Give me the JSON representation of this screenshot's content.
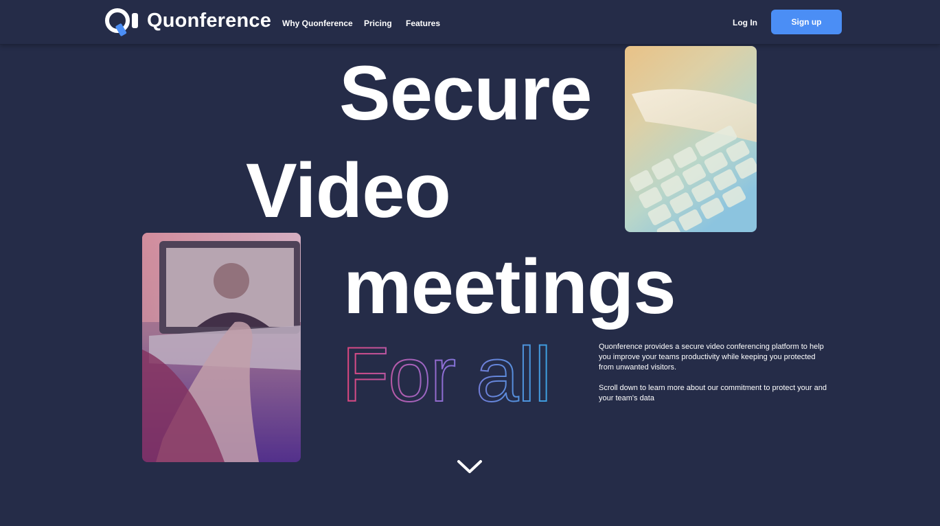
{
  "header": {
    "brand": "Quonference",
    "nav": [
      {
        "label": "Why Quonference"
      },
      {
        "label": "Pricing"
      },
      {
        "label": "Features"
      }
    ],
    "login_label": "Log In",
    "signup_label": "Sign up"
  },
  "hero": {
    "line1": "Secure",
    "line2": "Video",
    "line3": "meetings",
    "line4": "For all",
    "description_1": "Quonference provides a secure video conferencing platform to help you improve your teams productivity while keeping you protected from unwanted visitors.",
    "description_2": "Scroll down to learn more about our commitment to protect your and your team's data"
  },
  "icons": {
    "logo": "quonference-logo-icon",
    "scroll": "chevron-down-icon"
  },
  "colors": {
    "background": "#252c48",
    "accent": "#4b8ef5",
    "gradient_start": "#e0457b",
    "gradient_mid": "#8b6fd6",
    "gradient_end": "#3aa0e0"
  }
}
